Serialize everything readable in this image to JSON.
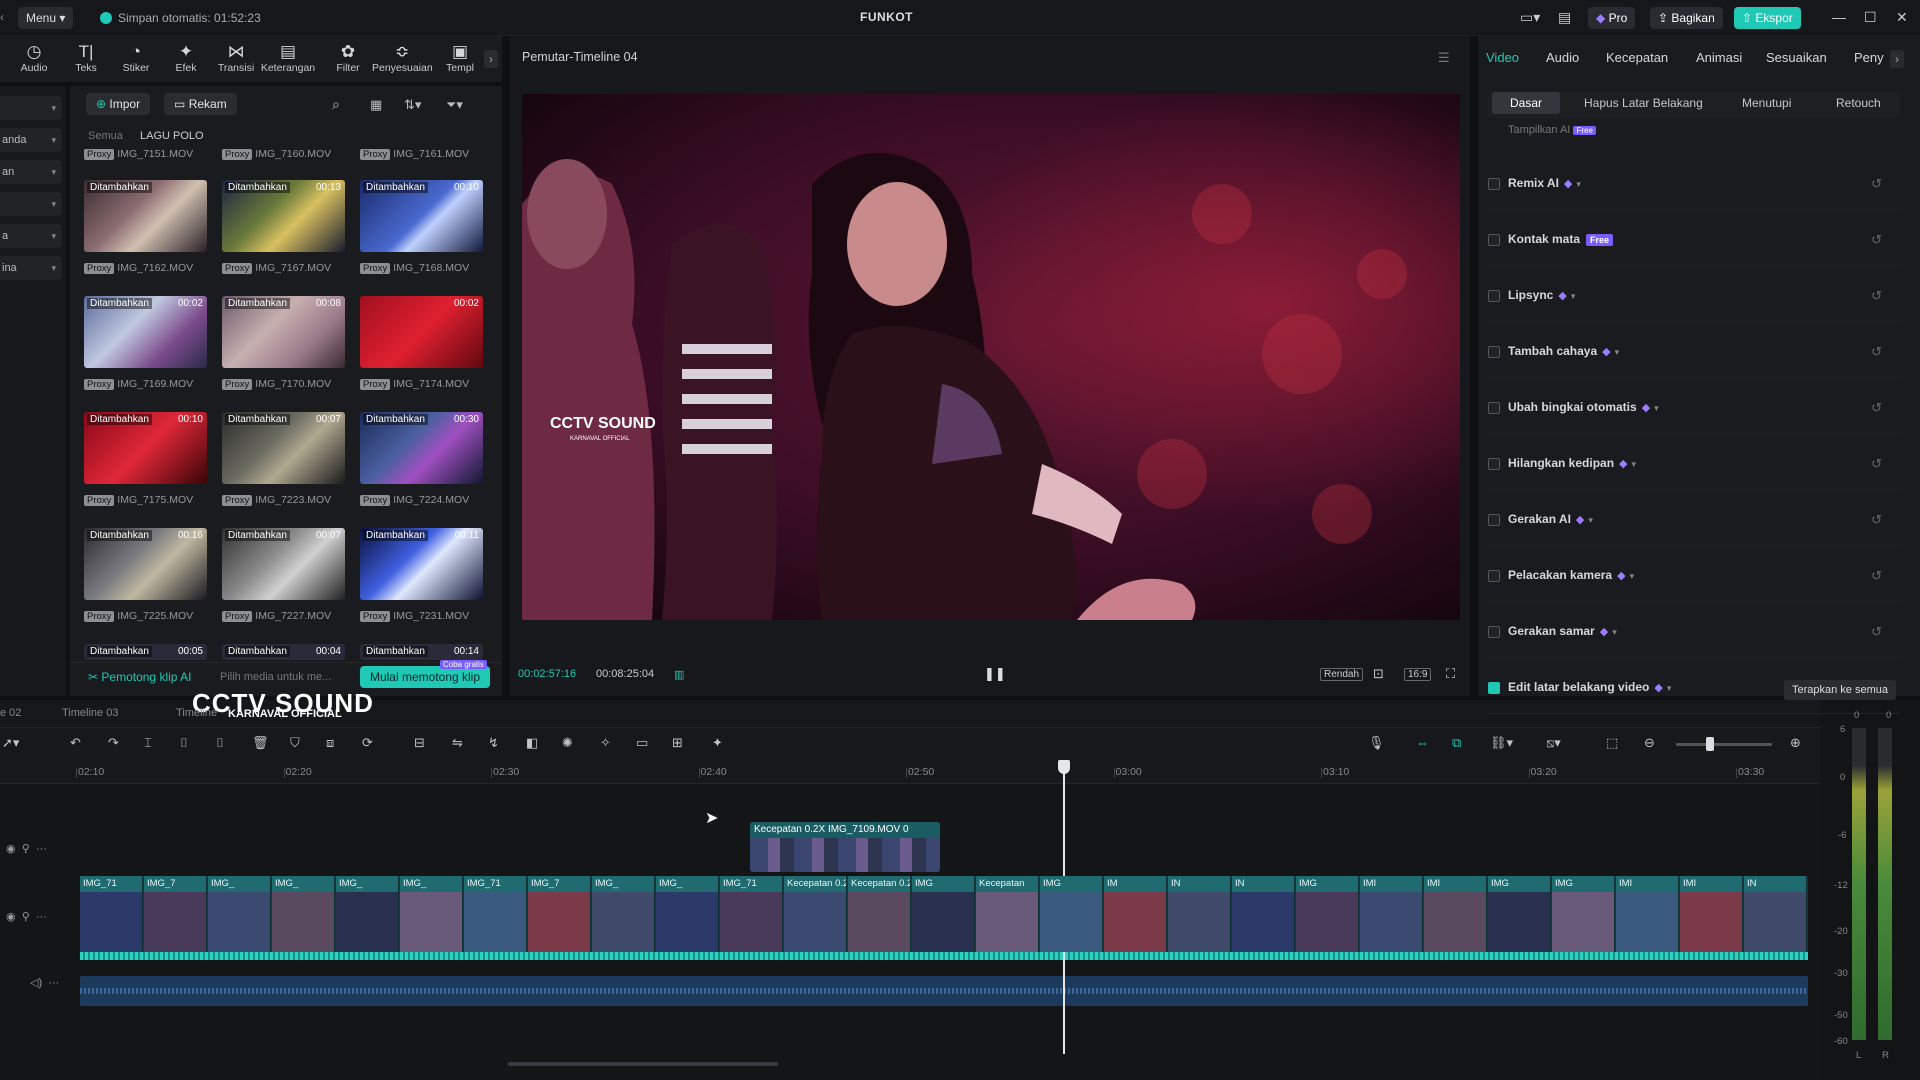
{
  "titlebar": {
    "menu": "Menu",
    "autosave": "Simpan otomatis: 01:52:23",
    "title": "FUNKOT",
    "pro": "Pro",
    "share": "Bagikan",
    "export": "Ekspor"
  },
  "tools": [
    {
      "label": "Audio",
      "icon": "audio-icon"
    },
    {
      "label": "Teks",
      "icon": "text-icon"
    },
    {
      "label": "Stiker",
      "icon": "sticker-icon"
    },
    {
      "label": "Efek",
      "icon": "effects-icon"
    },
    {
      "label": "Transisi",
      "icon": "transition-icon"
    },
    {
      "label": "Keterangan",
      "icon": "captions-icon"
    },
    {
      "label": "Filter",
      "icon": "filter-icon"
    },
    {
      "label": "Penyesuaian",
      "icon": "adjust-icon"
    },
    {
      "label": "Templ",
      "icon": "template-icon"
    }
  ],
  "sidebar": {
    "items": [
      "",
      "anda",
      "an",
      "",
      "a",
      "ina"
    ]
  },
  "media": {
    "import": "Impor",
    "record": "Rekam",
    "crumb_all": "Semua",
    "crumb_folder": "LAGU POLO",
    "top_files": [
      "IMG_7151.MOV",
      "IMG_7160.MOV",
      "IMG_7161.MOV"
    ],
    "thumbs": [
      {
        "badge": "Ditambahkan",
        "dur": "",
        "file": "IMG_7162.MOV"
      },
      {
        "badge": "Ditambahkan",
        "dur": "00:13",
        "file": "IMG_7167.MOV"
      },
      {
        "badge": "Ditambahkan",
        "dur": "00:10",
        "file": "IMG_7168.MOV"
      },
      {
        "badge": "Ditambahkan",
        "dur": "00:02",
        "file": "IMG_7169.MOV"
      },
      {
        "badge": "Ditambahkan",
        "dur": "00:08",
        "file": "IMG_7170.MOV"
      },
      {
        "badge": "",
        "dur": "00:02",
        "file": "IMG_7174.MOV"
      },
      {
        "badge": "Ditambahkan",
        "dur": "00:10",
        "file": "IMG_7175.MOV"
      },
      {
        "badge": "Ditambahkan",
        "dur": "00:07",
        "file": "IMG_7223.MOV"
      },
      {
        "badge": "Ditambahkan",
        "dur": "00:30",
        "file": "IMG_7224.MOV"
      },
      {
        "badge": "Ditambahkan",
        "dur": "00:16",
        "file": "IMG_7225.MOV"
      },
      {
        "badge": "Ditambahkan",
        "dur": "00:07",
        "file": "IMG_7227.MOV"
      },
      {
        "badge": "Ditambahkan",
        "dur": "00:11",
        "file": "IMG_7231.MOV"
      }
    ],
    "bottom": [
      {
        "badge": "Ditambahkan",
        "dur": "00:05"
      },
      {
        "badge": "Ditambahkan",
        "dur": "00:04"
      },
      {
        "badge": "Ditambahkan",
        "dur": "00:14"
      }
    ],
    "proxy": "Proxy",
    "ai_cutter": "Pemotong klip AI",
    "pick_hint": "Pilih media untuk me...",
    "start_cut": "Mulai memotong klip",
    "free_tag": "Coba gratis"
  },
  "player": {
    "title": "Pemutar-Timeline 04",
    "watermark": "CCTV SOUND",
    "watermark_sub": "KARNAVAL OFFICIAL",
    "current": "00:02:57:16",
    "total": "00:08:25:04",
    "quality": "Rendah",
    "ratio": "16:9"
  },
  "props": {
    "tabs": [
      "Video",
      "Audio",
      "Kecepatan",
      "Animasi",
      "Sesuaikan",
      "Peny"
    ],
    "subtabs": [
      "Dasar",
      "Hapus Latar Belakang",
      "Menutupi",
      "Retouch"
    ],
    "rows": [
      {
        "label": "Remix AI",
        "free": false
      },
      {
        "label": "Kontak mata",
        "free": true
      },
      {
        "label": "Lipsync",
        "free": false
      },
      {
        "label": "Tambah cahaya",
        "free": false
      },
      {
        "label": "Ubah bingkai otomatis",
        "free": false
      },
      {
        "label": "Hilangkan kedipan",
        "free": false
      },
      {
        "label": "Gerakan AI",
        "free": false
      },
      {
        "label": "Pelacakan kamera",
        "free": false
      },
      {
        "label": "Gerakan samar",
        "free": false
      },
      {
        "label": "Edit latar belakang video",
        "free": false
      }
    ],
    "free_label": "Free",
    "apply_all": "Terapkan ke semua",
    "top_partial": "Tampilkan AI"
  },
  "timeline": {
    "tabs": [
      "e 02",
      "Timeline 03",
      "Timeline"
    ],
    "overlay_title": "CCTV SOUND",
    "overlay_sub": "KARNAVAL OFFICIAL",
    "ruler": [
      "02:10",
      "02:20",
      "02:30",
      "02:40",
      "02:50",
      "03:00",
      "03:10",
      "03:20",
      "03:30"
    ],
    "overlay_clip": "Kecepatan 0.2X  IMG_7109.MOV  0",
    "clip_labels": [
      "IMG_71",
      "IMG_7",
      "IMG_",
      "IMG_",
      "IMG_",
      "IMG_",
      "IMG_71",
      "IMG_7",
      "IMG_",
      "IMG_",
      "IMG_71",
      "Kecepatan 0.2X",
      "Kecepatan 0.2X",
      "IMG",
      "Kecepatan",
      "IMG",
      "IM",
      "IN",
      "IN",
      "IMG",
      "IMI",
      "IMI",
      "IMG",
      "IMG",
      "IMI",
      "IMI",
      "IN"
    ],
    "meter": [
      "0",
      "0",
      "6",
      "0",
      "-6",
      "-12",
      "-20",
      "-30",
      "-50",
      "-60",
      "L",
      "R"
    ]
  },
  "colors": {
    "accent": "#1fc9b5",
    "gem": "#9b7dff",
    "clip": "#1f6b70"
  }
}
